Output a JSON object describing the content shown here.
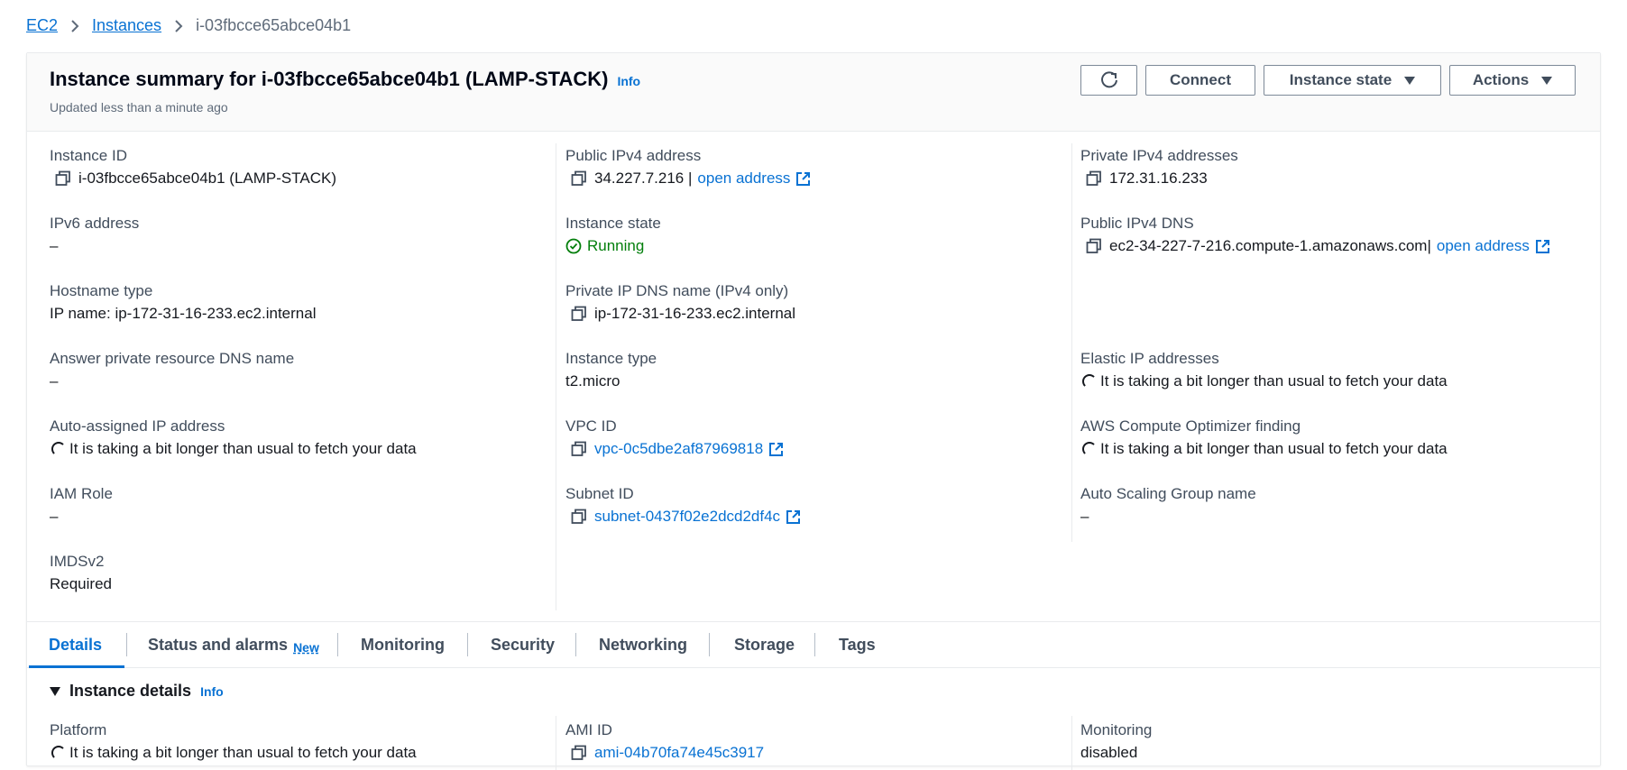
{
  "breadcrumb": {
    "ec2": "EC2",
    "instances": "Instances",
    "current": "i-03fbcce65abce04b1"
  },
  "header": {
    "title": "Instance summary for i-03fbcce65abce04b1 (LAMP-STACK)",
    "info": "Info",
    "subtitle": "Updated less than a minute ago",
    "buttons": {
      "refresh_icon": "refresh-icon",
      "connect": "Connect",
      "instance_state": "Instance state",
      "actions": "Actions"
    }
  },
  "summary": {
    "col1": [
      {
        "label": "Instance ID",
        "value": "i-03fbcce65abce04b1 (LAMP-STACK)"
      },
      {
        "label": "IPv6 address",
        "value": "–"
      },
      {
        "label": "Hostname type",
        "value": "IP name: ip-172-31-16-233.ec2.internal"
      },
      {
        "label": "Answer private resource DNS name",
        "value": "–"
      },
      {
        "label": "Auto-assigned IP address",
        "value": "It is taking a bit longer than usual to fetch your data"
      },
      {
        "label": "IAM Role",
        "value": "–"
      },
      {
        "label": "IMDSv2",
        "value": "Required"
      }
    ],
    "col2": [
      {
        "label": "Public IPv4 address",
        "value": "34.227.7.216 |",
        "link": "open address"
      },
      {
        "label": "Instance state",
        "value": "Running"
      },
      {
        "label": "Private IP DNS name (IPv4 only)",
        "value": "ip-172-31-16-233.ec2.internal"
      },
      {
        "label": "Instance type",
        "value": "t2.micro"
      },
      {
        "label": "VPC ID",
        "link": "vpc-0c5dbe2af87969818"
      },
      {
        "label": "Subnet ID",
        "link": "subnet-0437f02e2dcd2df4c"
      }
    ],
    "col3": [
      {
        "label": "Private IPv4 addresses",
        "value": "172.31.16.233"
      },
      {
        "label": "Public IPv4 DNS",
        "value": "ec2-34-227-7-216.compute-1.amazonaws.com|",
        "link": "open address"
      },
      {
        "label": "Elastic IP addresses",
        "value": "It is taking a bit longer than usual to fetch your data"
      },
      {
        "label": "AWS Compute Optimizer finding",
        "value": "It is taking a bit longer than usual to fetch your data"
      },
      {
        "label": "Auto Scaling Group name",
        "value": "–"
      }
    ]
  },
  "tabs": [
    {
      "label": "Details"
    },
    {
      "label": "Status and alarms",
      "badge": "New"
    },
    {
      "label": "Monitoring"
    },
    {
      "label": "Security"
    },
    {
      "label": "Networking"
    },
    {
      "label": "Storage"
    },
    {
      "label": "Tags"
    }
  ],
  "details": {
    "title": "Instance details",
    "info": "Info",
    "platform_label": "Platform",
    "platform_value": "It is taking a bit longer than usual to fetch your data",
    "ami_label": "AMI ID",
    "ami_value": "ami-04b70fa74e45c3917",
    "monitoring_label": "Monitoring",
    "monitoring_value": "disabled"
  },
  "colors": {
    "link": "#0972d3",
    "running": "#037f0c",
    "text": "#16191f",
    "label": "#414d5c"
  }
}
